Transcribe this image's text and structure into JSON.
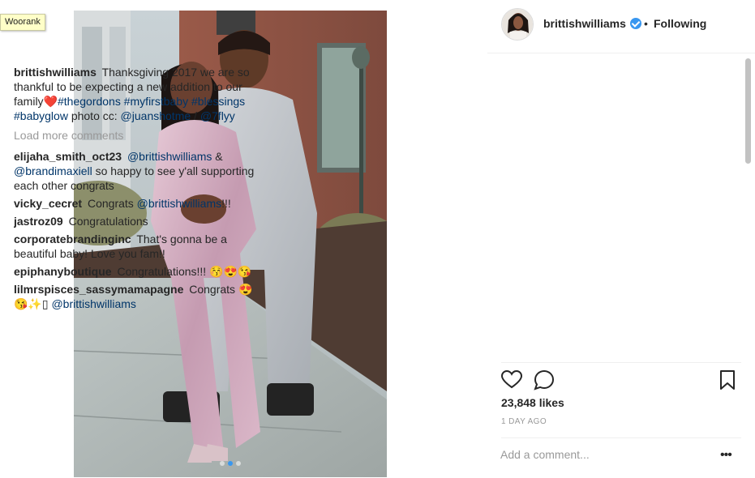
{
  "extension": {
    "badge_label": "Woorank"
  },
  "post": {
    "username": "brittishwilliams",
    "follow_status": "Following",
    "separator": "•",
    "image_alt": "Couple standing on sidewalk, woman in lilac velvet tracksuit, man in grey hoodie",
    "carousel": {
      "total": 3,
      "active_index": 1
    },
    "caption": {
      "username": "brittishwilliams",
      "text_1": "Thanksgiving 2017 we are so thankful to be expecting a new addition to our family",
      "emoji_heart": "❤️",
      "hashtags": [
        "#thegordons",
        "#myfirstbaby",
        "#blessings",
        "#babyglow"
      ],
      "credit_prefix": "photo cc:",
      "credit_1": "@juanshotme",
      "credit_sep": "/",
      "credit_2": "@7flyy"
    },
    "load_more_label": "Load more comments",
    "comments": [
      {
        "username": "elijaha_smith_oct23",
        "mention_1": "@brittishwilliams",
        "amp": "&",
        "mention_2": "@brandimaxiell",
        "text": "so happy to see y'all supporting each other congrats"
      },
      {
        "username": "vicky_cecret",
        "text": "Congrats",
        "mention": "@brittishwilliams",
        "suffix": "!!!"
      },
      {
        "username": "jastroz09",
        "text": "Congratulations"
      },
      {
        "username": "corporatebrandinginc",
        "text": "That's gonna be a beautiful baby! Love you fam!!"
      },
      {
        "username": "epiphanyboutique",
        "text": "Congratulations!!! 😚😍😘"
      },
      {
        "username": "lilmrspisces_sassymamapagne",
        "text": "Congrats",
        "emojis": "😍😘✨▯",
        "mention": "@brittishwilliams"
      }
    ],
    "likes_text": "23,848 likes",
    "timestamp": "1 DAY AGO",
    "add_comment_placeholder": "Add a comment...",
    "more_options_label": "•••"
  },
  "colors": {
    "link": "#003569",
    "muted": "#999999",
    "verified": "#3897f0",
    "text": "#262626"
  }
}
